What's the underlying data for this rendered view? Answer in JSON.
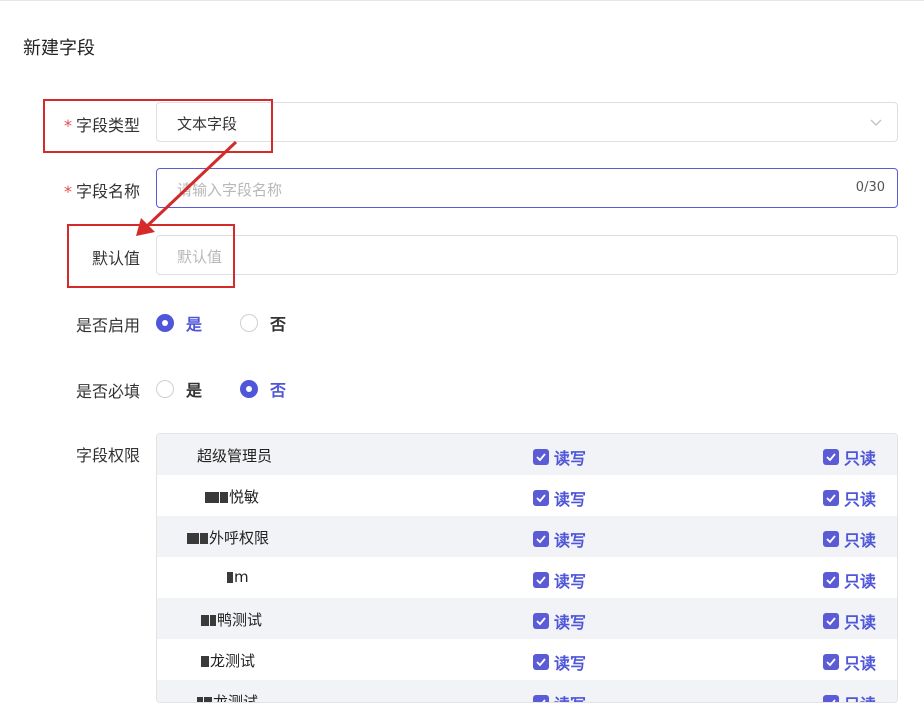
{
  "page_title": "新建字段",
  "field_type": {
    "label": "字段类型",
    "value": "文本字段"
  },
  "field_name": {
    "label": "字段名称",
    "placeholder": "请输入字段名称",
    "counter": "0/30"
  },
  "default_value": {
    "label": "默认值",
    "placeholder": "默认值"
  },
  "enabled": {
    "label": "是否启用",
    "yes": "是",
    "no": "否",
    "selected": "yes"
  },
  "required": {
    "label": "是否必填",
    "yes": "是",
    "no": "否",
    "selected": "no"
  },
  "permissions": {
    "label": "字段权限",
    "read_write": "读写",
    "read_only": "只读",
    "rows": [
      {
        "name": "超级管理员"
      },
      {
        "name": "悦敏"
      },
      {
        "name": "外呼权限"
      },
      {
        "name": "m"
      },
      {
        "name": "鸭测试"
      },
      {
        "name": "龙测试"
      },
      {
        "name": "龙测试"
      }
    ]
  },
  "colors": {
    "accent": "#4f56d9",
    "required": "#e5484d",
    "annotation": "#d42a2a"
  }
}
